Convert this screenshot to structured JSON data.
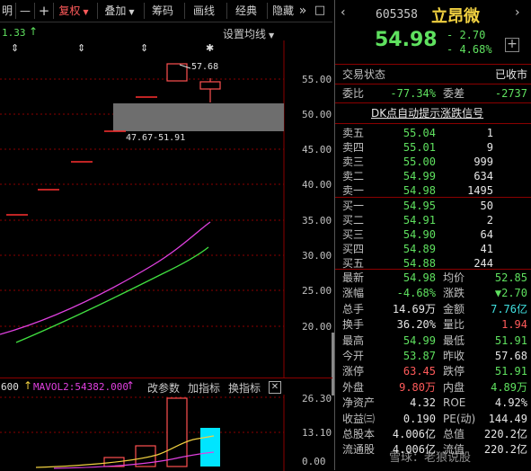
{
  "toolbar": {
    "first": "明",
    "minus": "—",
    "plus": "+",
    "fuquan": "复权",
    "diejia": "叠加",
    "chouma": "筹码",
    "huaxian": "画线",
    "jingdian": "经典",
    "yincang": "隐藏",
    "more": "»",
    "square": "□"
  },
  "chart": {
    "ma_value": "1.33",
    "ma_settings": "设置均线",
    "price_ticks": [
      "55.00",
      "50.00",
      "45.00",
      "40.00",
      "35.00",
      "30.00",
      "25.00",
      "20.00"
    ],
    "high_label": "57.68",
    "range_label": "47.67-51.91",
    "markers": [
      "⇕",
      "⇕",
      "⇕",
      "✱"
    ]
  },
  "volume_panel": {
    "left_value": "600",
    "mavol2": "MAVOL2:54382.000",
    "change_params": "改参数",
    "add_indicator": "加指标",
    "switch_indicator": "换指标",
    "ticks": [
      "26.30",
      "13.10",
      "0.00"
    ]
  },
  "stock": {
    "code": "605358",
    "name": "立昂微",
    "price": "54.98",
    "change": "- 2.70",
    "change_pct": "- 4.68%",
    "add_icon": "+",
    "status_label": "交易状态",
    "status_value": "已收市",
    "weibi_label": "委比",
    "weibi_value": "-77.34%",
    "weicha_label": "委差",
    "weicha_value": "-2737",
    "signal": "DK点自动提示涨跌信号"
  },
  "asks": [
    {
      "label": "卖五",
      "price": "55.04",
      "vol": "1"
    },
    {
      "label": "卖四",
      "price": "55.01",
      "vol": "9"
    },
    {
      "label": "卖三",
      "price": "55.00",
      "vol": "999"
    },
    {
      "label": "卖二",
      "price": "54.99",
      "vol": "634"
    },
    {
      "label": "卖一",
      "price": "54.98",
      "vol": "1495"
    }
  ],
  "bids": [
    {
      "label": "买一",
      "price": "54.95",
      "vol": "50"
    },
    {
      "label": "买二",
      "price": "54.91",
      "vol": "2"
    },
    {
      "label": "买三",
      "price": "54.90",
      "vol": "64"
    },
    {
      "label": "买四",
      "price": "54.89",
      "vol": "41"
    },
    {
      "label": "买五",
      "price": "54.88",
      "vol": "244"
    }
  ],
  "stats": [
    {
      "l1": "最新",
      "v1": "54.98",
      "c1": "g",
      "l2": "均价",
      "v2": "52.85",
      "c2": "g"
    },
    {
      "l1": "涨幅",
      "v1": "-4.68%",
      "c1": "g",
      "l2": "涨跌",
      "v2": "▼2.70",
      "c2": "g"
    },
    {
      "l1": "总手",
      "v1": "14.69万",
      "c1": "w",
      "l2": "金额",
      "v2": "7.76亿",
      "c2": "c"
    },
    {
      "l1": "换手",
      "v1": "36.20%",
      "c1": "w",
      "l2": "量比",
      "v2": "1.94",
      "c2": "r"
    },
    {
      "l1": "最高",
      "v1": "54.99",
      "c1": "g",
      "l2": "最低",
      "v2": "51.91",
      "c2": "g"
    },
    {
      "l1": "今开",
      "v1": "53.87",
      "c1": "g",
      "l2": "昨收",
      "v2": "57.68",
      "c2": "w"
    },
    {
      "l1": "涨停",
      "v1": "63.45",
      "c1": "r",
      "l2": "跌停",
      "v2": "51.91",
      "c2": "g"
    },
    {
      "l1": "外盘",
      "v1": "9.80万",
      "c1": "r",
      "l2": "内盘",
      "v2": "4.89万",
      "c2": "g"
    },
    {
      "l1": "净资产",
      "v1": "4.32",
      "c1": "w",
      "l2": "ROE",
      "v2": "4.92%",
      "c2": "w"
    },
    {
      "l1": "收益㈢",
      "v1": "0.190",
      "c1": "w",
      "l2": "PE(动)",
      "v2": "144.49",
      "c2": "w"
    },
    {
      "l1": "总股本",
      "v1": "4.006亿",
      "c1": "w",
      "l2": "总值",
      "v2": "220.2亿",
      "c2": "w"
    },
    {
      "l1": "流通股",
      "v1": "4.006亿",
      "c1": "w",
      "l2": "流值",
      "v2": "220.2亿",
      "c2": "w"
    }
  ],
  "watermark": "雪球：老狼说股",
  "colors": {
    "up": "#ff5a5a",
    "down": "#5fe15f",
    "ma_magenta": "#e040e0",
    "ma_green": "#40e040",
    "volume_cyan": "#00e5ff"
  }
}
